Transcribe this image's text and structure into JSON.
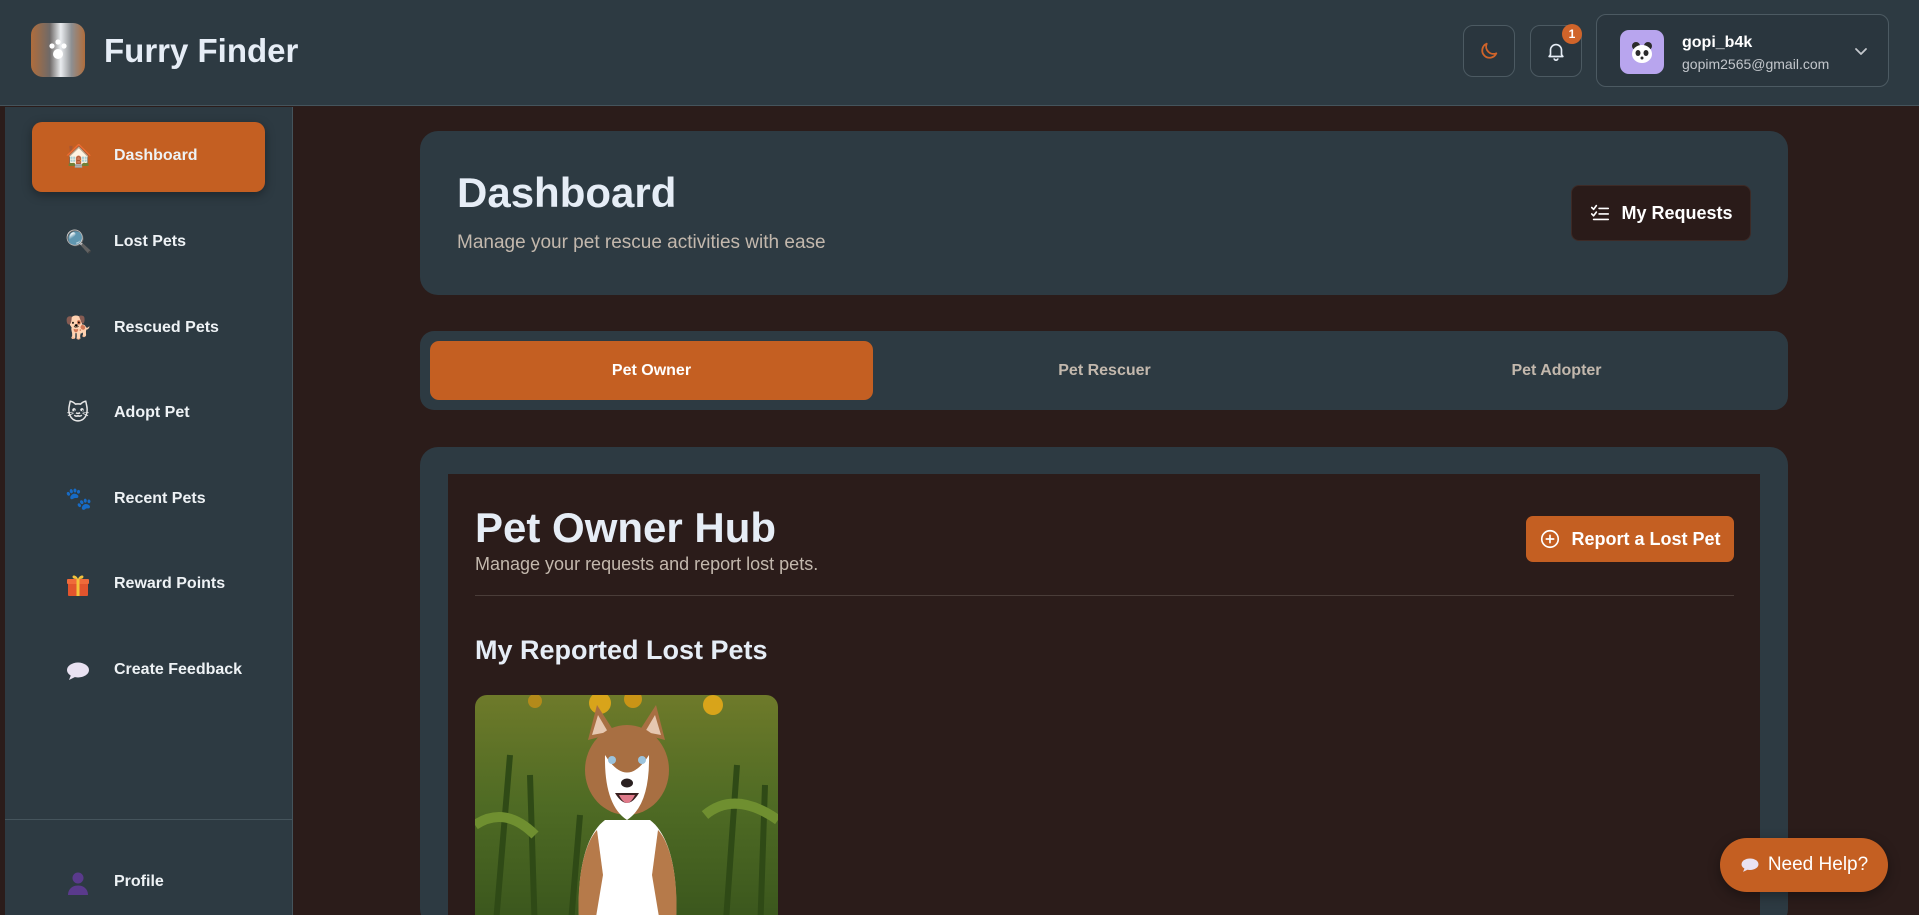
{
  "app": {
    "title": "Furry Finder"
  },
  "header": {
    "notifications_count": "1",
    "user": {
      "name": "gopi_b4k",
      "email": "gopim2565@gmail.com"
    }
  },
  "sidebar": {
    "items": [
      {
        "label": "Dashboard",
        "icon": "house-icon",
        "active": true
      },
      {
        "label": "Lost Pets",
        "icon": "magnifier-icon",
        "active": false
      },
      {
        "label": "Rescued Pets",
        "icon": "pet-hug-icon",
        "active": false
      },
      {
        "label": "Adopt Pet",
        "icon": "cat-face-icon",
        "active": false
      },
      {
        "label": "Recent Pets",
        "icon": "paw-prints-icon",
        "active": false
      },
      {
        "label": "Reward Points",
        "icon": "gift-icon",
        "active": false
      },
      {
        "label": "Create Feedback",
        "icon": "speech-bubble-icon",
        "active": false
      }
    ],
    "footer": {
      "label": "Profile",
      "icon": "person-icon"
    }
  },
  "page": {
    "title": "Dashboard",
    "subtitle": "Manage your pet rescue activities with ease",
    "my_requests_label": "My Requests"
  },
  "tabs": [
    {
      "label": "Pet Owner",
      "active": true
    },
    {
      "label": "Pet Rescuer",
      "active": false
    },
    {
      "label": "Pet Adopter",
      "active": false
    }
  ],
  "hub": {
    "title": "Pet Owner Hub",
    "subtitle": "Manage your requests and report lost pets.",
    "report_button": "Report a Lost Pet",
    "section_title": "My Reported Lost Pets"
  },
  "help": {
    "label": "Need Help?"
  },
  "colors": {
    "accent": "#c45f22",
    "panel": "#2d3a42",
    "background": "#2b1c1a",
    "text": "#e6edf6"
  }
}
